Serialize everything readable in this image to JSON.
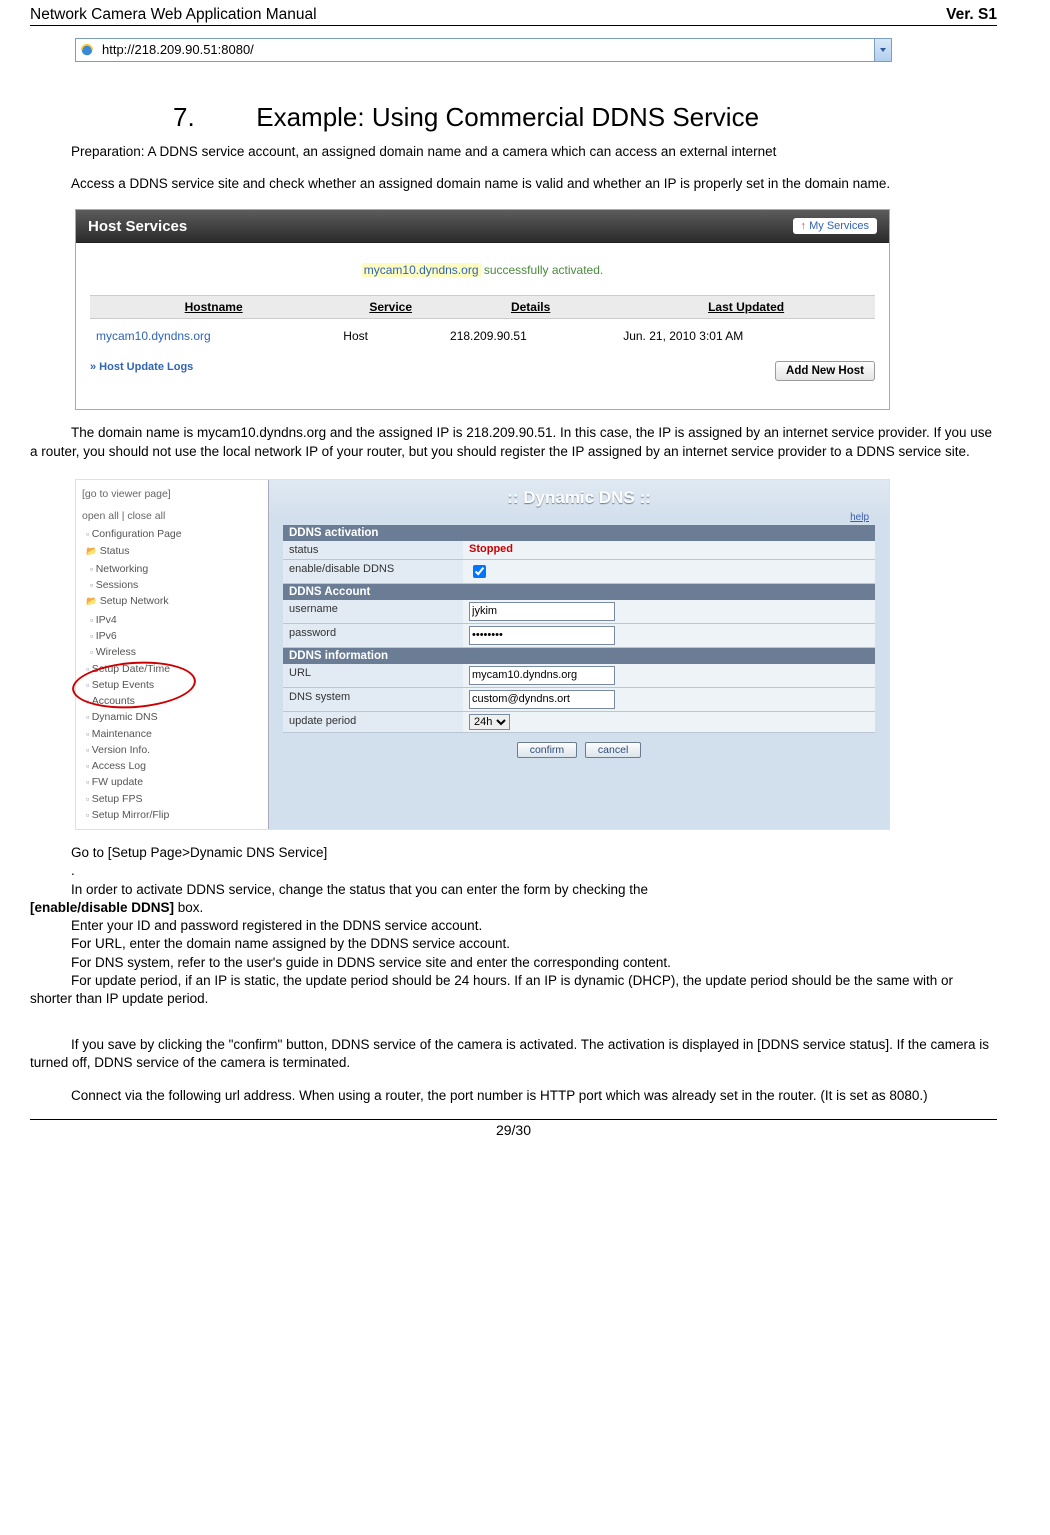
{
  "header": {
    "left": "Network Camera Web Application Manual",
    "right": "Ver. S1"
  },
  "footer": {
    "page": "29/30"
  },
  "addrbar": {
    "url": "http://218.209.90.51:8080/"
  },
  "heading": {
    "num": "7.",
    "title": "Example: Using Commercial DDNS Service"
  },
  "p1": "Preparation: A DDNS service account, an assigned domain name and a camera which can access an external internet",
  "p2": "Access a DDNS service site and check whether an assigned domain name is valid and whether an IP is properly set in the domain name.",
  "dyndns": {
    "bar_title": "Host Services",
    "my_services_arrow": "↑",
    "my_services": "My Services",
    "msg_host": "mycam10.dyndns.org",
    "msg_tail": " successfully activated.",
    "th": [
      "Hostname",
      "Service",
      "Details",
      "Last Updated"
    ],
    "row": {
      "host": "mycam10.dyndns.org",
      "service": "Host",
      "details": "218.209.90.51",
      "updated": "Jun. 21, 2010 3:01 AM"
    },
    "logs_link": "» Host Update Logs",
    "add_btn": "Add New Host"
  },
  "p3": "The domain name is mycam10.dyndns.org and the assigned IP is 218.209.90.51. In this case, the IP is assigned by an internet service provider. If you use a router, you should not use the local network IP of your router, but you should register the IP assigned by an internet service provider to a DDNS service site.",
  "tree": {
    "top1": "[go to viewer page]",
    "top2": "open all | close all",
    "root": "Configuration Page",
    "status": "Status",
    "status_items": [
      "Networking",
      "Sessions"
    ],
    "net": "Setup Network",
    "net_items": [
      "IPv4",
      "IPv6",
      "Wireless"
    ],
    "others": [
      "Setup Date/Time",
      "Setup Events",
      "Accounts",
      "Dynamic DNS",
      "Maintenance",
      "Version Info.",
      "Access Log",
      "FW update",
      "Setup FPS",
      "Setup Mirror/Flip"
    ]
  },
  "cfg": {
    "title": ":: Dynamic DNS ::",
    "help": "help",
    "sec1": "DDNS activation",
    "status_lab": "status",
    "status_val": "Stopped",
    "enable_lab": "enable/disable DDNS",
    "sec2": "DDNS Account",
    "user_lab": "username",
    "user_val": "jykim",
    "pass_lab": "password",
    "pass_val": "••••••••",
    "sec3": "DDNS information",
    "url_lab": "URL",
    "url_val": "mycam10.dyndns.org",
    "dns_lab": "DNS system",
    "dns_val": "custom@dyndns.ort",
    "upd_lab": "update period",
    "upd_val": "24h",
    "confirm": "confirm",
    "cancel": "cancel"
  },
  "p4": "Go to [Setup Page>Dynamic DNS Service]",
  "p4b": ".",
  "p5a": "In order to activate DDNS service, change the status that you can enter the form by checking the ",
  "p5bold": "[enable/disable DDNS]",
  "p5b": " box.",
  "p6": "Enter your ID and password registered in the DDNS service account.",
  "p7": "For URL, enter the domain name assigned by the DDNS service account.",
  "p8": "For DNS system, refer to the user's guide in DDNS service site and enter the corresponding content.",
  "p9": "For update period, if an IP is static, the update period should be 24 hours. If an IP is dynamic (DHCP), the update period should be the same with or shorter than IP update period.",
  "p10": "If you save by clicking the \"confirm\" button, DDNS service of the camera is activated. The activation is displayed in [DDNS service status]. If the camera is turned off, DDNS service of the camera is terminated.",
  "p11": "Connect via the following url address. When using a router, the port number is HTTP port which was already set in the router. (It is set as 8080.)"
}
